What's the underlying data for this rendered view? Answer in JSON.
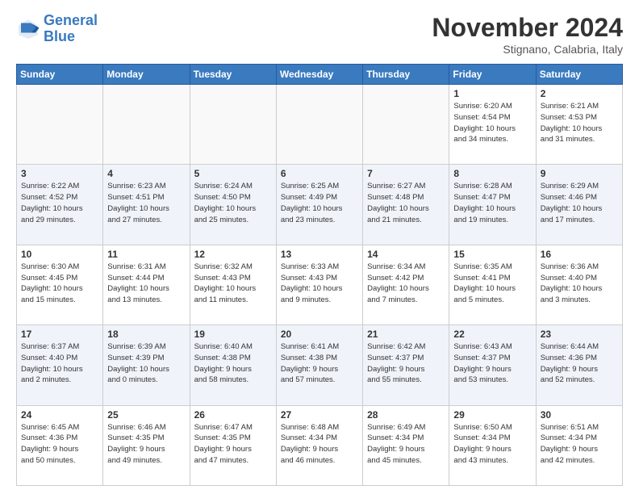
{
  "header": {
    "logo_line1": "General",
    "logo_line2": "Blue",
    "month": "November 2024",
    "location": "Stignano, Calabria, Italy"
  },
  "weekdays": [
    "Sunday",
    "Monday",
    "Tuesday",
    "Wednesday",
    "Thursday",
    "Friday",
    "Saturday"
  ],
  "rows": [
    [
      {
        "day": "",
        "info": ""
      },
      {
        "day": "",
        "info": ""
      },
      {
        "day": "",
        "info": ""
      },
      {
        "day": "",
        "info": ""
      },
      {
        "day": "",
        "info": ""
      },
      {
        "day": "1",
        "info": "Sunrise: 6:20 AM\nSunset: 4:54 PM\nDaylight: 10 hours\nand 34 minutes."
      },
      {
        "day": "2",
        "info": "Sunrise: 6:21 AM\nSunset: 4:53 PM\nDaylight: 10 hours\nand 31 minutes."
      }
    ],
    [
      {
        "day": "3",
        "info": "Sunrise: 6:22 AM\nSunset: 4:52 PM\nDaylight: 10 hours\nand 29 minutes."
      },
      {
        "day": "4",
        "info": "Sunrise: 6:23 AM\nSunset: 4:51 PM\nDaylight: 10 hours\nand 27 minutes."
      },
      {
        "day": "5",
        "info": "Sunrise: 6:24 AM\nSunset: 4:50 PM\nDaylight: 10 hours\nand 25 minutes."
      },
      {
        "day": "6",
        "info": "Sunrise: 6:25 AM\nSunset: 4:49 PM\nDaylight: 10 hours\nand 23 minutes."
      },
      {
        "day": "7",
        "info": "Sunrise: 6:27 AM\nSunset: 4:48 PM\nDaylight: 10 hours\nand 21 minutes."
      },
      {
        "day": "8",
        "info": "Sunrise: 6:28 AM\nSunset: 4:47 PM\nDaylight: 10 hours\nand 19 minutes."
      },
      {
        "day": "9",
        "info": "Sunrise: 6:29 AM\nSunset: 4:46 PM\nDaylight: 10 hours\nand 17 minutes."
      }
    ],
    [
      {
        "day": "10",
        "info": "Sunrise: 6:30 AM\nSunset: 4:45 PM\nDaylight: 10 hours\nand 15 minutes."
      },
      {
        "day": "11",
        "info": "Sunrise: 6:31 AM\nSunset: 4:44 PM\nDaylight: 10 hours\nand 13 minutes."
      },
      {
        "day": "12",
        "info": "Sunrise: 6:32 AM\nSunset: 4:43 PM\nDaylight: 10 hours\nand 11 minutes."
      },
      {
        "day": "13",
        "info": "Sunrise: 6:33 AM\nSunset: 4:43 PM\nDaylight: 10 hours\nand 9 minutes."
      },
      {
        "day": "14",
        "info": "Sunrise: 6:34 AM\nSunset: 4:42 PM\nDaylight: 10 hours\nand 7 minutes."
      },
      {
        "day": "15",
        "info": "Sunrise: 6:35 AM\nSunset: 4:41 PM\nDaylight: 10 hours\nand 5 minutes."
      },
      {
        "day": "16",
        "info": "Sunrise: 6:36 AM\nSunset: 4:40 PM\nDaylight: 10 hours\nand 3 minutes."
      }
    ],
    [
      {
        "day": "17",
        "info": "Sunrise: 6:37 AM\nSunset: 4:40 PM\nDaylight: 10 hours\nand 2 minutes."
      },
      {
        "day": "18",
        "info": "Sunrise: 6:39 AM\nSunset: 4:39 PM\nDaylight: 10 hours\nand 0 minutes."
      },
      {
        "day": "19",
        "info": "Sunrise: 6:40 AM\nSunset: 4:38 PM\nDaylight: 9 hours\nand 58 minutes."
      },
      {
        "day": "20",
        "info": "Sunrise: 6:41 AM\nSunset: 4:38 PM\nDaylight: 9 hours\nand 57 minutes."
      },
      {
        "day": "21",
        "info": "Sunrise: 6:42 AM\nSunset: 4:37 PM\nDaylight: 9 hours\nand 55 minutes."
      },
      {
        "day": "22",
        "info": "Sunrise: 6:43 AM\nSunset: 4:37 PM\nDaylight: 9 hours\nand 53 minutes."
      },
      {
        "day": "23",
        "info": "Sunrise: 6:44 AM\nSunset: 4:36 PM\nDaylight: 9 hours\nand 52 minutes."
      }
    ],
    [
      {
        "day": "24",
        "info": "Sunrise: 6:45 AM\nSunset: 4:36 PM\nDaylight: 9 hours\nand 50 minutes."
      },
      {
        "day": "25",
        "info": "Sunrise: 6:46 AM\nSunset: 4:35 PM\nDaylight: 9 hours\nand 49 minutes."
      },
      {
        "day": "26",
        "info": "Sunrise: 6:47 AM\nSunset: 4:35 PM\nDaylight: 9 hours\nand 47 minutes."
      },
      {
        "day": "27",
        "info": "Sunrise: 6:48 AM\nSunset: 4:34 PM\nDaylight: 9 hours\nand 46 minutes."
      },
      {
        "day": "28",
        "info": "Sunrise: 6:49 AM\nSunset: 4:34 PM\nDaylight: 9 hours\nand 45 minutes."
      },
      {
        "day": "29",
        "info": "Sunrise: 6:50 AM\nSunset: 4:34 PM\nDaylight: 9 hours\nand 43 minutes."
      },
      {
        "day": "30",
        "info": "Sunrise: 6:51 AM\nSunset: 4:34 PM\nDaylight: 9 hours\nand 42 minutes."
      }
    ]
  ]
}
